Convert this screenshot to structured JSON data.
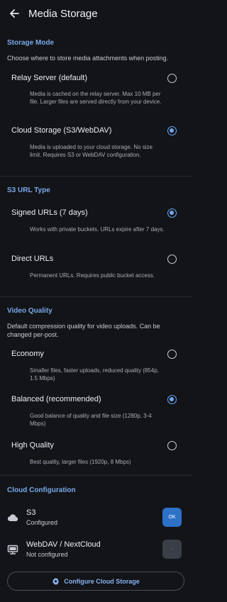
{
  "appbar": {
    "title": "Media Storage",
    "back_icon": "arrow-left-icon"
  },
  "storage_mode": {
    "title": "Storage Mode",
    "description": "Choose where to store media attachments when posting.",
    "options": [
      {
        "label": "Relay Server (default)",
        "description": "Media is cached on the relay server. Max 10 MB per file. Larger files are served directly from your device.",
        "selected": false
      },
      {
        "label": "Cloud Storage (S3/WebDAV)",
        "description": "Media is uploaded to your cloud storage. No size limit. Requires S3 or WebDAV configuration.",
        "selected": true
      }
    ]
  },
  "s3_url_type": {
    "title": "S3 URL Type",
    "options": [
      {
        "label": "Signed URLs (7 days)",
        "description": "Works with private buckets. URLs expire after 7 days.",
        "selected": true
      },
      {
        "label": "Direct URLs",
        "description": "Permanent URLs. Requires public bucket access.",
        "selected": false
      }
    ]
  },
  "video_quality": {
    "title": "Video Quality",
    "description": "Default compression quality for video uploads. Can be changed per-post.",
    "options": [
      {
        "label": "Economy",
        "description": "Smaller files, faster uploads, reduced quality (854p, 1.5 Mbps)",
        "selected": false
      },
      {
        "label": "Balanced (recommended)",
        "description": "Good balance of quality and file size (1280p, 3-4 Mbps)",
        "selected": true
      },
      {
        "label": "High Quality",
        "description": "Best quality, larger files (1920p, 8 Mbps)",
        "selected": false
      }
    ]
  },
  "cloud_config": {
    "title": "Cloud Configuration",
    "items": [
      {
        "name": "S3",
        "status": "Configured",
        "badge": "OK",
        "icon": "cloud-icon"
      },
      {
        "name": "WebDAV / NextCloud",
        "status": "Not configured",
        "badge": "-",
        "icon": "server-icon"
      }
    ],
    "button_label": "Configure Cloud Storage",
    "button_icon": "gear-icon"
  },
  "colors": {
    "background": "#121418",
    "accent": "#6ea8f0",
    "section_title": "#7aa8e8",
    "ok_badge": "#2d72c8"
  }
}
